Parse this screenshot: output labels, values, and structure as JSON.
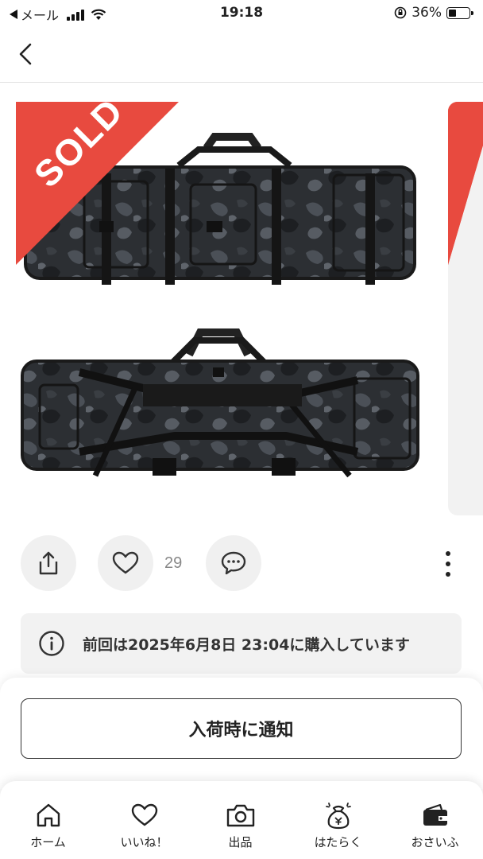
{
  "status_bar": {
    "back_app": "メール",
    "time": "19:18",
    "battery": "36%",
    "battery_level": 0.36
  },
  "product": {
    "sold_label": "SOLD",
    "like_count": "29"
  },
  "notice": {
    "text": "前回は2025年6月8日 23:04に購入しています"
  },
  "sheet": {
    "notify_label": "入荷時に通知"
  },
  "tab_bar": {
    "items": [
      {
        "label": "ホーム",
        "icon": "home-icon"
      },
      {
        "label": "いいね！",
        "icon": "heart-icon"
      },
      {
        "label": "出品",
        "icon": "camera-icon"
      },
      {
        "label": "はたらく",
        "icon": "money-bag-icon"
      },
      {
        "label": "おさいふ",
        "icon": "wallet-icon"
      }
    ]
  },
  "colors": {
    "sold_red": "#e84a3f",
    "bag_camo_dark": "#2a2d31",
    "bag_camo_mid": "#4a4f55"
  }
}
